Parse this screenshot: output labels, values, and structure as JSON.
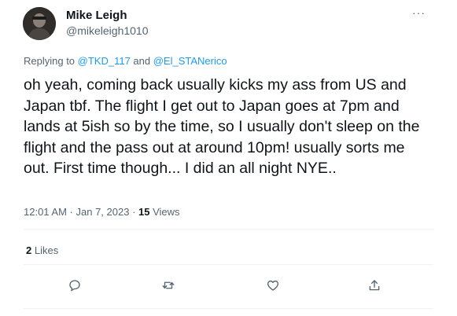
{
  "author": {
    "name": "Mike Leigh",
    "handle": "@mikeleigh1010",
    "avatar_icon": "profile-photo"
  },
  "more_label": "···",
  "replying": {
    "prefix": "Replying to ",
    "mention1": "@TKD_117",
    "joiner": " and ",
    "mention2": "@El_STANerico"
  },
  "tweet_text": "oh yeah, coming back usually kicks my ass from US and Japan tbf. The flight I get out to Japan goes at 7pm and lands at 5ish so by the time, so I usually don't sleep on the flight and the pass out at around 10pm! usually sorts me out. First time though... I did an all night NYE..",
  "meta": {
    "time": "12:01 AM",
    "sep1": " · ",
    "date": "Jan 7, 2023",
    "sep2": " · ",
    "views_count": "15",
    "views_label": " Views"
  },
  "likes": {
    "count": "2",
    "label": " Likes"
  },
  "actions": [
    "reply-icon",
    "retweet-icon",
    "like-icon",
    "share-icon"
  ],
  "colors": {
    "text": "#0f1419",
    "secondary": "#536471",
    "accent": "#1d9bf0",
    "divider": "#eff3f4"
  }
}
